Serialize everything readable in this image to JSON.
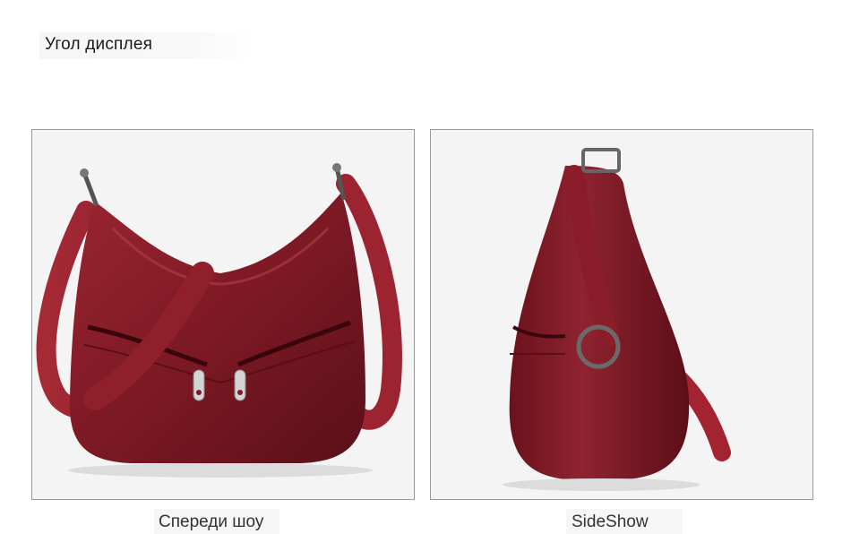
{
  "section": {
    "title": "Угол дисплея"
  },
  "photos": {
    "front": {
      "caption": "Спереди шоу",
      "bag_color": "#7e1a24"
    },
    "side": {
      "caption": "SideShow",
      "bag_color": "#7e1a24"
    }
  },
  "colors": {
    "background": "#ffffff",
    "frame_border": "#9a9a9a",
    "leather": "#7e1a24",
    "strap": "#a42330",
    "hardware": "#c8c8c8"
  }
}
